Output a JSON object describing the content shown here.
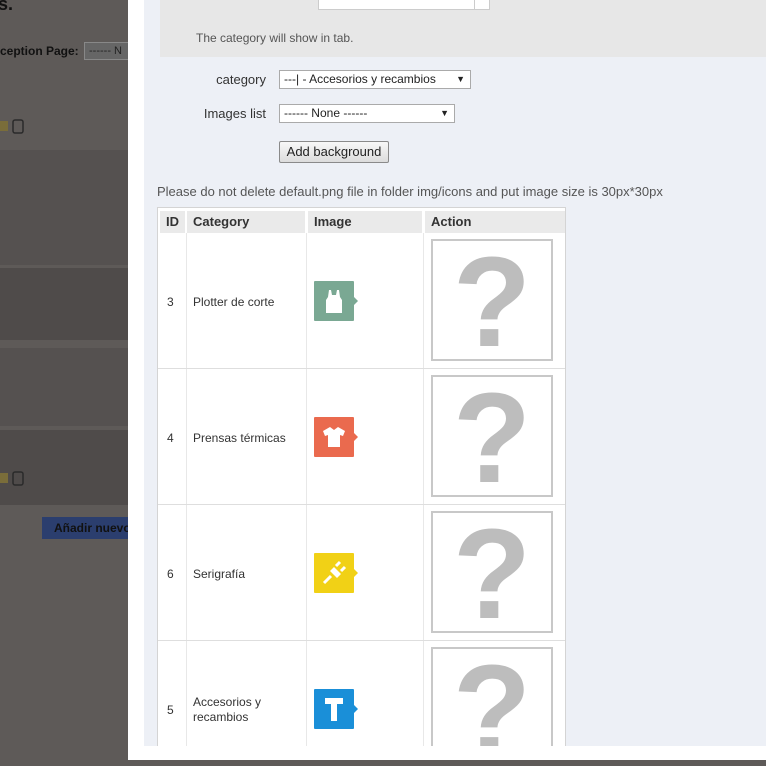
{
  "background": {
    "title_fragment": "s.",
    "label_fragment": "ception Page:",
    "select_fragment": "------ N",
    "button_fragment": "Añadir nuevo"
  },
  "modal": {
    "hint": "The category will show in tab.",
    "category_label": "category",
    "category_value": "---| - Accesorios y recambios",
    "images_label": "Images list",
    "images_value": "------ None ------",
    "add_button": "Add background",
    "note": "Please do not delete default.png file in folder img/icons and put image size is 30px*30px",
    "table": {
      "headers": [
        "ID",
        "Category",
        "Image",
        "Action"
      ],
      "rows": [
        {
          "id": "3",
          "category": "Plotter de corte",
          "icon": "tank-top-icon",
          "color": "#7aa893"
        },
        {
          "id": "4",
          "category": "Prensas térmicas",
          "icon": "tshirt-icon",
          "color": "#ea6a4e"
        },
        {
          "id": "6",
          "category": "Serigrafía",
          "icon": "plug-icon",
          "color": "#f1d116"
        },
        {
          "id": "5",
          "category": "Accesorios y recambios",
          "icon": "letter-t-icon",
          "color": "#1a8fd8"
        }
      ]
    }
  }
}
